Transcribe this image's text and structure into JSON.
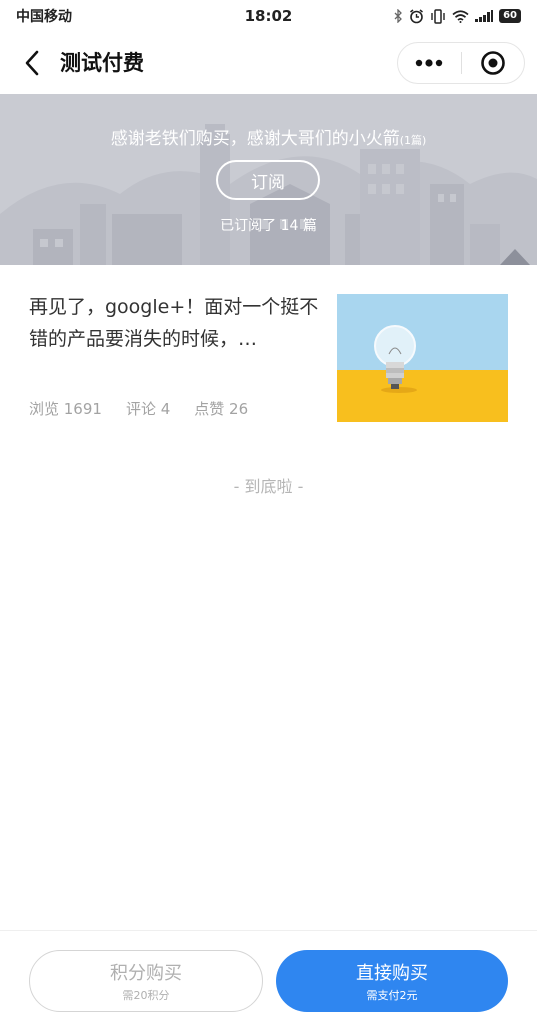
{
  "status_bar": {
    "carrier": "中国移动",
    "time": "18:02",
    "battery": "60"
  },
  "nav": {
    "title": "测试付费"
  },
  "banner": {
    "title": "感谢老铁们购买，感谢大哥们的小火箭",
    "title_suffix": "(1篇)",
    "subscribe_label": "订阅",
    "subscribed_text": "已订阅了 14 篇"
  },
  "article": {
    "title": "再见了，google+！面对一个挺不错的产品要消失的时候，…",
    "views": "浏览 1691",
    "comments": "评论 4",
    "likes": "点赞 26",
    "thumbnail_icon": "light-bulb"
  },
  "end_text": "- 到底啦 -",
  "bottom": {
    "points_buy_label": "积分购买",
    "points_buy_sub": "需20积分",
    "direct_buy_label": "直接购买",
    "direct_buy_sub": "需支付2元"
  },
  "colors": {
    "primary": "#2f86f0",
    "banner_bg": "#c9cbd2",
    "meta_text": "#a3a3a3",
    "thumb_sky": "#a9d6ef",
    "thumb_ground": "#f8bf1e"
  }
}
